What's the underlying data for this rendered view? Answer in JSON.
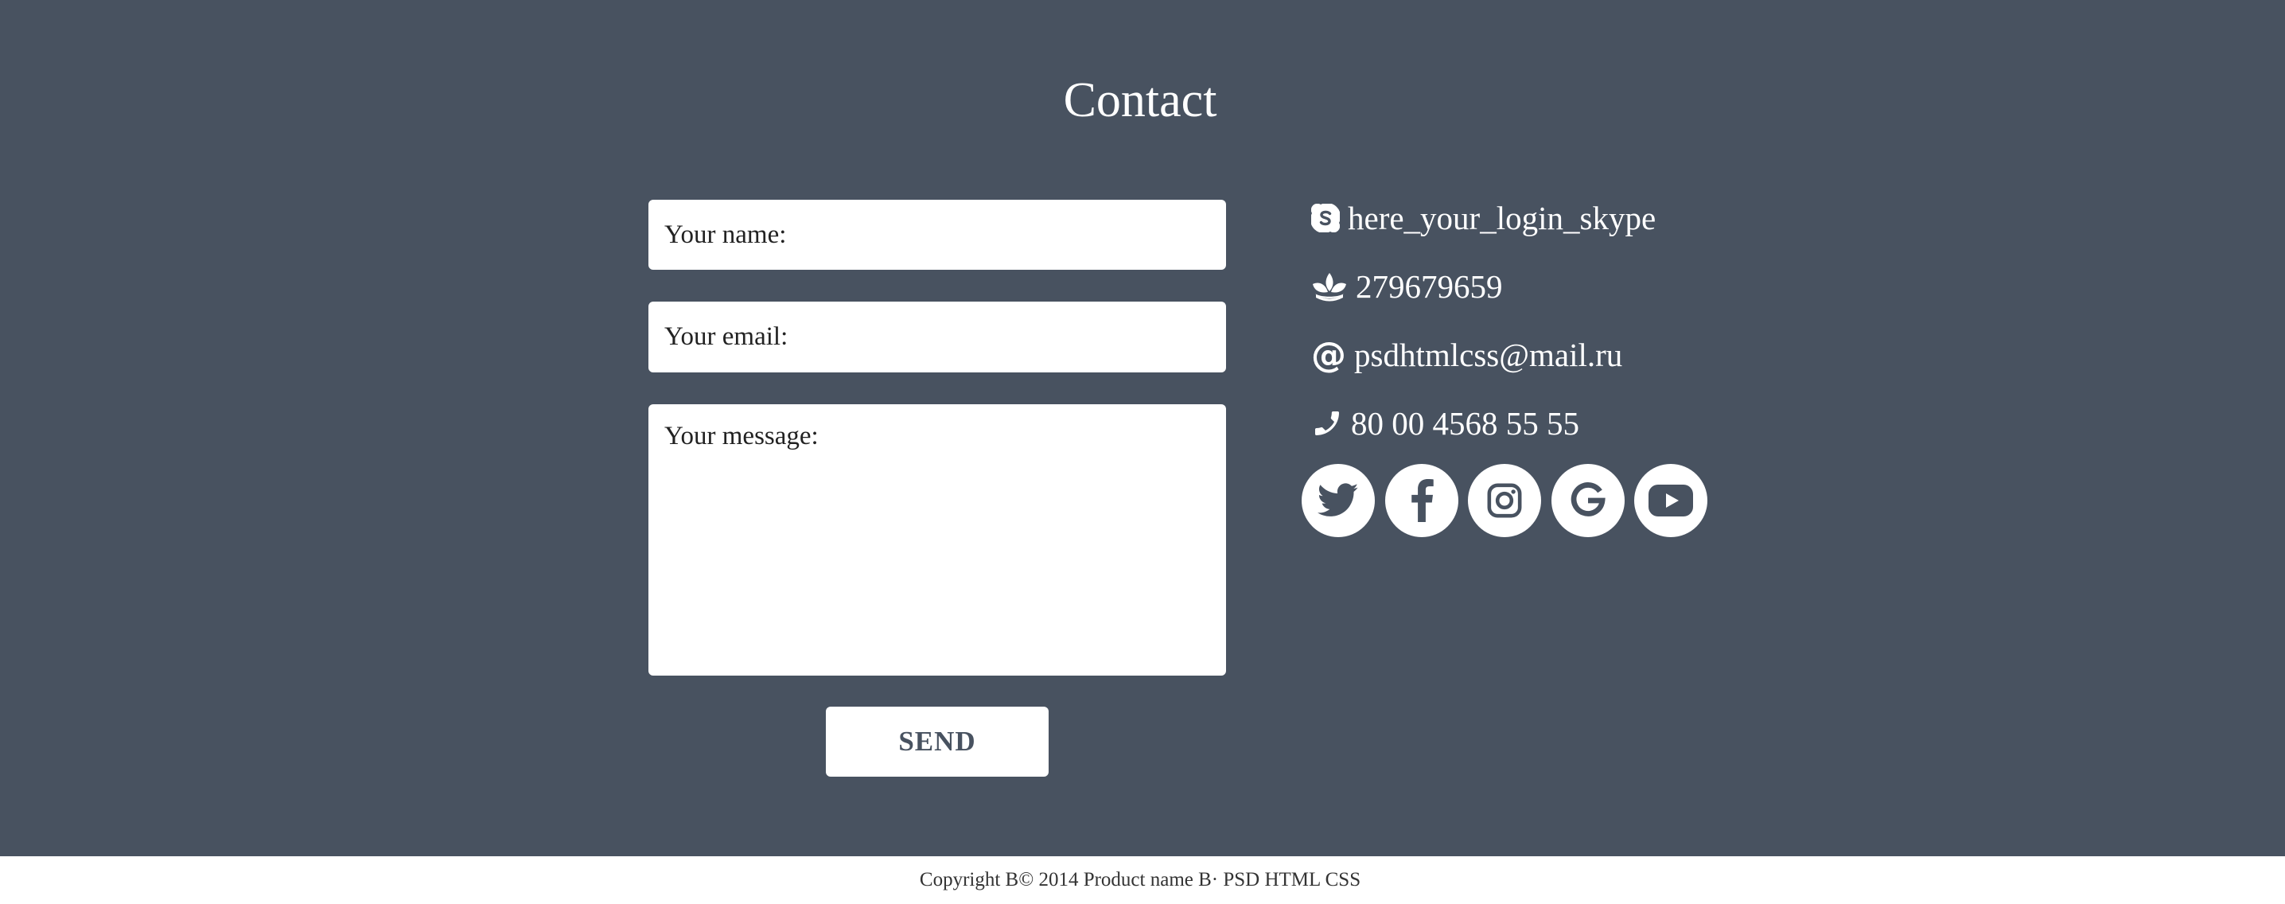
{
  "contact": {
    "title": "Contact",
    "form": {
      "name_placeholder": "Your name:",
      "email_placeholder": "Your email:",
      "message_placeholder": "Your message:",
      "send_label": "SEND"
    },
    "info": {
      "skype": "here_your_login_skype",
      "icq": "279679659",
      "email": "psdhtmlcss@mail.ru",
      "phone": "80 00 4568 55 55"
    },
    "social": [
      "twitter-icon",
      "facebook-icon",
      "instagram-icon",
      "google-icon",
      "youtube-icon"
    ]
  },
  "footer": {
    "copyright": "Copyright B© 2014 Product name B· PSD HTML CSS"
  },
  "colors": {
    "section_bg": "#485260",
    "text_light": "#ffffff",
    "footer_bg": "#ffffff",
    "footer_text": "#333333"
  }
}
